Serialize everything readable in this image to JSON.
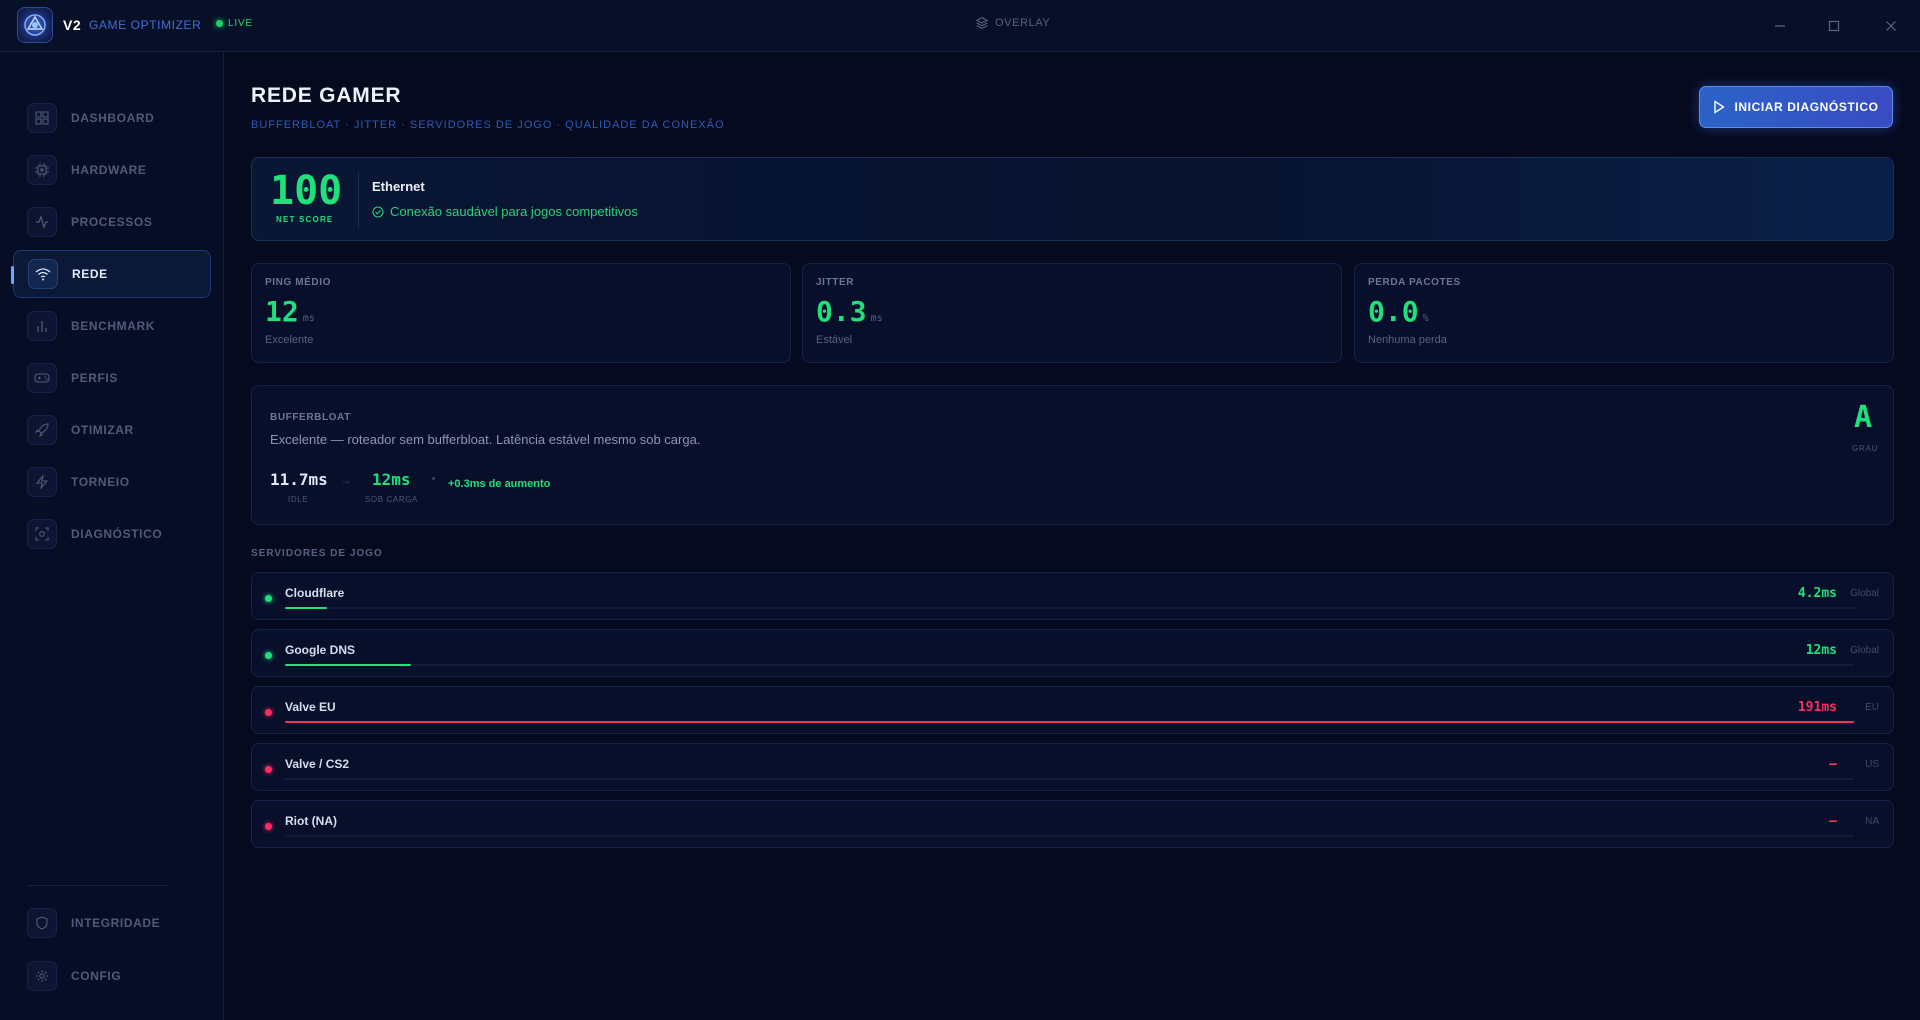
{
  "titlebar": {
    "brand_version": "V2",
    "brand_name": "GAME OPTIMIZER",
    "live_label": "LIVE",
    "overlay_label": "OVERLAY"
  },
  "sidebar": {
    "items": [
      {
        "label": "DASHBOARD",
        "icon": "grid-icon",
        "active": false
      },
      {
        "label": "HARDWARE",
        "icon": "cpu-icon",
        "active": false
      },
      {
        "label": "PROCESSOS",
        "icon": "activity-icon",
        "active": false
      },
      {
        "label": "REDE",
        "icon": "wifi-icon",
        "active": true
      },
      {
        "label": "BENCHMARK",
        "icon": "bar-chart-icon",
        "active": false
      },
      {
        "label": "PERFIS",
        "icon": "gamepad-icon",
        "active": false
      },
      {
        "label": "OTIMIZAR",
        "icon": "rocket-icon",
        "active": false
      },
      {
        "label": "TORNEIO",
        "icon": "bolt-icon",
        "active": false
      },
      {
        "label": "DIAGNÓSTICO",
        "icon": "scan-icon",
        "active": false
      }
    ],
    "bottom_items": [
      {
        "label": "INTEGRIDADE",
        "icon": "shield-icon"
      },
      {
        "label": "CONFIG",
        "icon": "gear-icon"
      }
    ]
  },
  "header": {
    "title": "REDE GAMER",
    "subtitle": "BUFFERBLOAT · JITTER · SERVIDORES DE JOGO · QUALIDADE DA CONEXÃO",
    "start_button": "INICIAR DIAGNÓSTICO"
  },
  "score": {
    "value": "100",
    "label": "NET SCORE",
    "connection_type": "Ethernet",
    "status": "Conexão saudável para jogos competitivos"
  },
  "metrics": [
    {
      "label": "PING MÉDIO",
      "value": "12",
      "unit": "ms",
      "note": "Excelente"
    },
    {
      "label": "JITTER",
      "value": "0.3",
      "unit": "ms",
      "note": "Estável"
    },
    {
      "label": "PERDA PACOTES",
      "value": "0.0",
      "unit": "%",
      "note": "Nenhuma perda"
    }
  ],
  "bufferbloat": {
    "label": "BUFFERBLOAT",
    "description": "Excelente — roteador sem bufferbloat. Latência estável mesmo sob carga.",
    "idle_value": "11.7ms",
    "idle_label": "IDLE",
    "load_value": "12ms",
    "load_label": "SOB CARGA",
    "increase": "+0.3ms de aumento",
    "grade": "A",
    "grade_label": "GRAU"
  },
  "servers": {
    "section_label": "SERVIDORES DE JOGO",
    "items": [
      {
        "name": "Cloudflare",
        "latency": "4.2ms",
        "region": "Global",
        "status": "ok",
        "bar_fraction": 0.027
      },
      {
        "name": "Google DNS",
        "latency": "12ms",
        "region": "Global",
        "status": "ok",
        "bar_fraction": 0.08
      },
      {
        "name": "Valve EU",
        "latency": "191ms",
        "region": "EU",
        "status": "bad",
        "bar_fraction": 1.0
      },
      {
        "name": "Valve / CS2",
        "latency": "—",
        "region": "US",
        "status": "bad",
        "bar_fraction": 0
      },
      {
        "name": "Riot (NA)",
        "latency": "—",
        "region": "NA",
        "status": "bad",
        "bar_fraction": 0
      }
    ]
  },
  "colors": {
    "good": "#1fe07a",
    "bad": "#ff2d5f",
    "accent": "#3f6fd4"
  }
}
